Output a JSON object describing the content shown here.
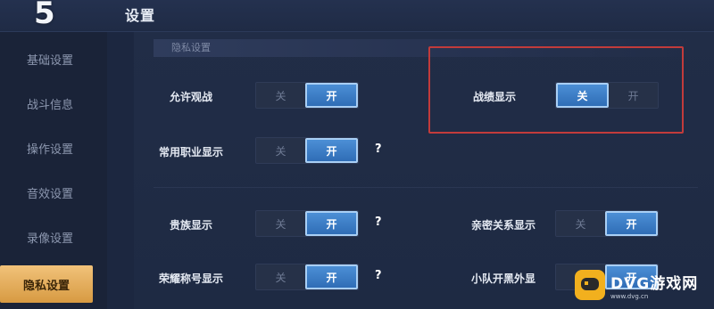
{
  "header": {
    "back_icon": "5",
    "title": "设置"
  },
  "sidebar": {
    "items": [
      {
        "label": "基础设置",
        "active": false
      },
      {
        "label": "战斗信息",
        "active": false
      },
      {
        "label": "操作设置",
        "active": false
      },
      {
        "label": "音效设置",
        "active": false
      },
      {
        "label": "录像设置",
        "active": false
      },
      {
        "label": "隐私设置",
        "active": true
      }
    ]
  },
  "section": {
    "title": "隐私设置"
  },
  "toggle_labels": {
    "off": "关",
    "on": "开"
  },
  "settings": {
    "allow_spectate": {
      "label": "允许观战",
      "value": "开"
    },
    "battle_record": {
      "label": "战绩显示",
      "value": "关"
    },
    "common_role": {
      "label": "常用职业显示",
      "value": "开",
      "help": "?"
    },
    "noble": {
      "label": "贵族显示",
      "value": "开",
      "help": "?"
    },
    "intimacy": {
      "label": "亲密关系显示",
      "value": "开"
    },
    "honor_title": {
      "label": "荣耀称号显示",
      "value": "开",
      "help": "?"
    },
    "team_link": {
      "label": "小队开黑外显",
      "value": "开"
    }
  },
  "colors": {
    "accent_on": "#3d7fcb",
    "sidebar_active": "#e3ad5a",
    "highlight": "#c23b3b"
  },
  "watermark": {
    "main": "DVG游戏网",
    "sub": "www.dvg.cn"
  }
}
